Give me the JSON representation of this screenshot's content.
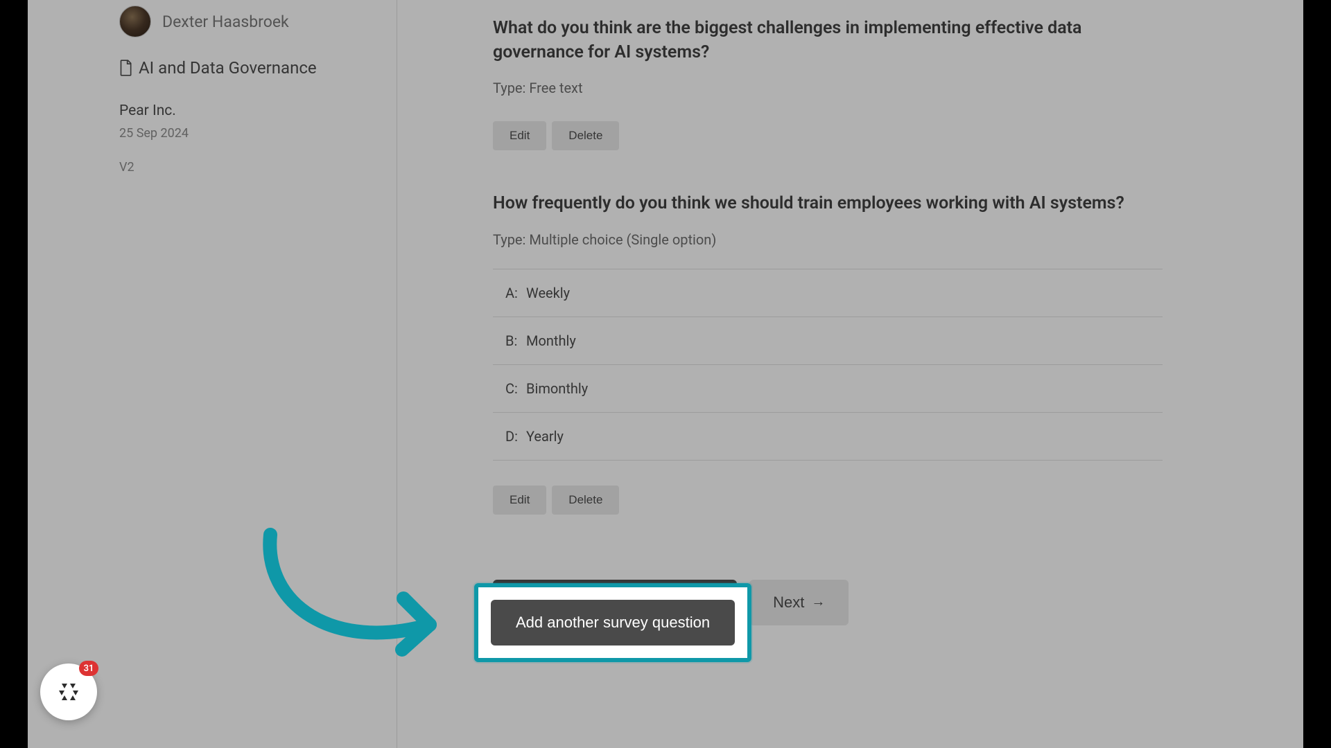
{
  "sidebar": {
    "user_name": "Dexter Haasbroek",
    "doc_title": "AI and Data Governance",
    "company": "Pear Inc.",
    "date": "25 Sep 2024",
    "version": "V2"
  },
  "questions": [
    {
      "title": "What do you think are the biggest challenges in implementing effective data governance for AI systems?",
      "type_label": "Type: Free text",
      "edit_label": "Edit",
      "delete_label": "Delete"
    },
    {
      "title": "How frequently do you think we should train employees working with AI systems?",
      "type_label": "Type: Multiple choice (Single option)",
      "options": [
        {
          "key": "A:",
          "value": "Weekly"
        },
        {
          "key": "B:",
          "value": "Monthly"
        },
        {
          "key": "C:",
          "value": "Bimonthly"
        },
        {
          "key": "D:",
          "value": "Yearly"
        }
      ],
      "edit_label": "Edit",
      "delete_label": "Delete"
    }
  ],
  "footer": {
    "add_label": "Add another survey question",
    "next_label": "Next"
  },
  "fab": {
    "badge_count": "31"
  },
  "colors": {
    "accent": "#0f98a8"
  }
}
